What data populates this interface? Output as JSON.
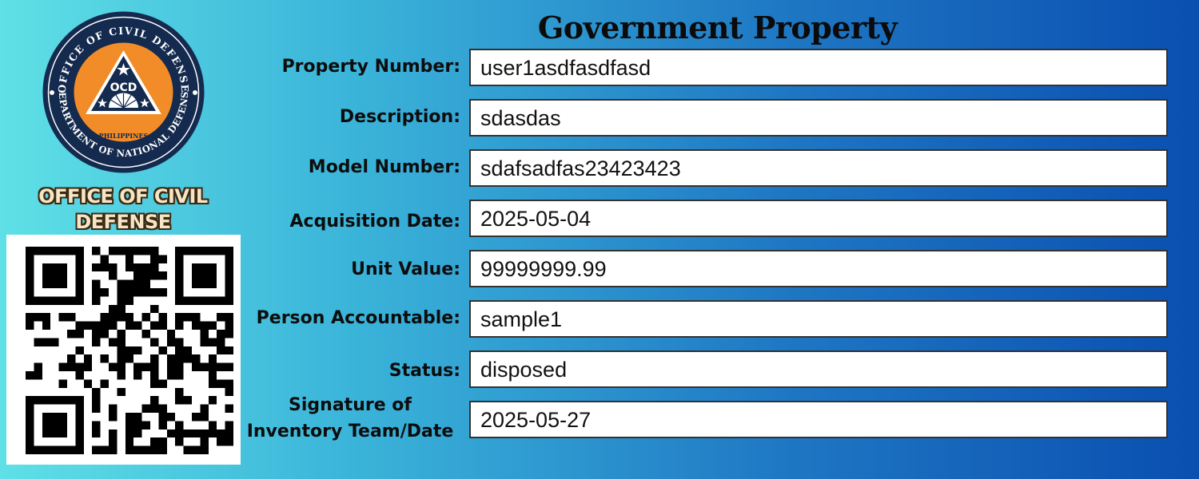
{
  "header": {
    "title": "Government Property"
  },
  "logo": {
    "icon": "ocd-seal-icon",
    "ring_text_top": "OFFICE OF CIVIL DEFENSE",
    "ring_text_bottom": "DEPARTMENT OF NATIONAL DEFENSE",
    "center_text": "OCD",
    "country_text": "PHILIPPINES",
    "colors": {
      "ring": "#142a4e",
      "fill": "#f28c28",
      "triangle": "#142a4e"
    }
  },
  "org": {
    "line1": "OFFICE OF CIVIL",
    "line2": "DEFENSE"
  },
  "qr": {
    "icon": "qr-code-icon"
  },
  "fields": [
    {
      "label": "Property Number:",
      "value": "user1asdfasdfasd"
    },
    {
      "label": "Description:",
      "value": "sdasdas"
    },
    {
      "label": "Model Number:",
      "value": "sdafsadfas23423423"
    },
    {
      "label": "Acquisition Date:",
      "value": "2025-05-04"
    },
    {
      "label": "Unit Value:",
      "value": "99999999.99"
    },
    {
      "label": "Person Accountable:",
      "value": "sample1"
    },
    {
      "label": "Status:",
      "value": "disposed"
    },
    {
      "label_line1": "Signature of",
      "label_line2": "Inventory Team/Date",
      "value": "2025-05-27"
    }
  ]
}
